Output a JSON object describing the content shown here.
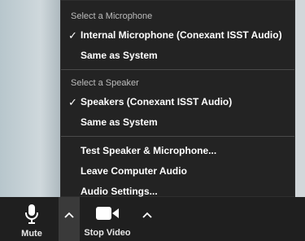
{
  "microphone": {
    "header": "Select a Microphone",
    "items": [
      {
        "label": "Internal Microphone (Conexant ISST Audio)",
        "checked": true
      },
      {
        "label": "Same as System",
        "checked": false
      }
    ]
  },
  "speaker": {
    "header": "Select a Speaker",
    "items": [
      {
        "label": "Speakers (Conexant ISST Audio)",
        "checked": true
      },
      {
        "label": "Same as System",
        "checked": false
      }
    ]
  },
  "actions": [
    {
      "label": "Test Speaker & Microphone..."
    },
    {
      "label": "Leave Computer Audio"
    },
    {
      "label": "Audio Settings..."
    }
  ],
  "check_glyph": "✓",
  "toolbar": {
    "mute_label": "Mute",
    "stop_video_label": "Stop Video",
    "mute_icon": "microphone-icon",
    "video_icon": "video-camera-icon"
  },
  "colors": {
    "menu_bg": "#232323",
    "toolbar_bg": "#1f1f1f",
    "chevron_active_bg": "#3a3a3a"
  }
}
